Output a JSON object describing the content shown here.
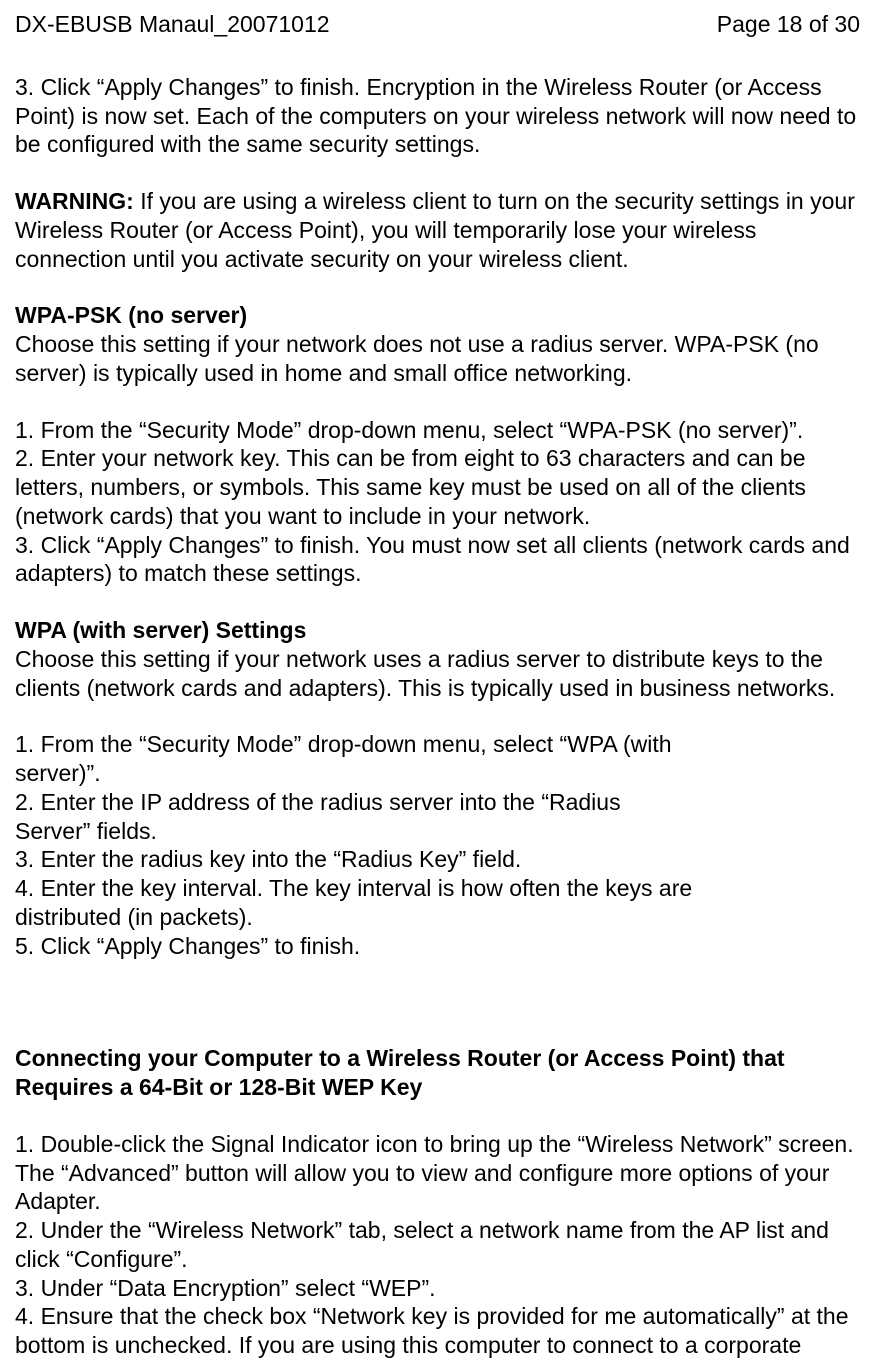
{
  "header": {
    "doc_title": "DX-EBUSB Manaul_20071012",
    "page_indicator": "Page 18 of 30"
  },
  "p1": "3. Click “Apply Changes” to finish. Encryption in the Wireless Router (or Access Point) is now set. Each of the computers on your wireless network will now need to be configured with the same security settings.",
  "p2_label": "WARNING:",
  "p2_text": " If you are using a wireless client to turn on the security settings in your Wireless Router (or Access Point), you will temporarily lose your wireless connection until you activate security on your wireless client.",
  "h1": "WPA-PSK (no server)",
  "p3": "Choose this setting if your network does not use a radius server. WPA-PSK (no server) is typically used in home and small office networking.",
  "p4a": "1. From the “Security Mode” drop-down menu, select “WPA-PSK (no server)”.",
  "p4b": "2. Enter your network key. This can be from eight to 63 characters and can be letters, numbers, or symbols. This same key must be used on all of the clients (network cards) that you want to include in your network.",
  "p4c": "3. Click “Apply Changes” to finish. You must now set all clients (network cards and adapters) to match these settings.",
  "h2": "WPA (with server) Settings",
  "p5": "Choose this setting if your network uses a radius server to distribute keys to the clients (network cards and adapters). This is typically used in business networks.",
  "p6a": "1. From the “Security Mode” drop-down menu, select “WPA (with",
  "p6b": "server)”.",
  "p6c": "2. Enter the IP address of the radius server into the “Radius",
  "p6d": "Server” fields.",
  "p6e": "3. Enter the radius key into the “Radius Key” field.",
  "p6f": "4. Enter the key interval. The key interval is how often the keys are",
  "p6g": "distributed (in packets).",
  "p6h": "5. Click “Apply Changes” to finish.",
  "h3a": "Connecting your Computer to a Wireless Router (or Access Point) that",
  "h3b": "Requires a 64-Bit or 128-Bit WEP Key",
  "p7a": "1. Double-click the Signal Indicator icon to bring up the “Wireless Network” screen. The “Advanced” button will allow you to view and configure more options of your Adapter.",
  "p7b": "2. Under the “Wireless Network” tab, select a network name from the AP list and click “Configure”.",
  "p7c": "3. Under “Data Encryption” select “WEP”.",
  "p7d": "4. Ensure that the check box “Network key is provided for me automatically” at the bottom is unchecked. If you are using this computer to connect to a corporate"
}
